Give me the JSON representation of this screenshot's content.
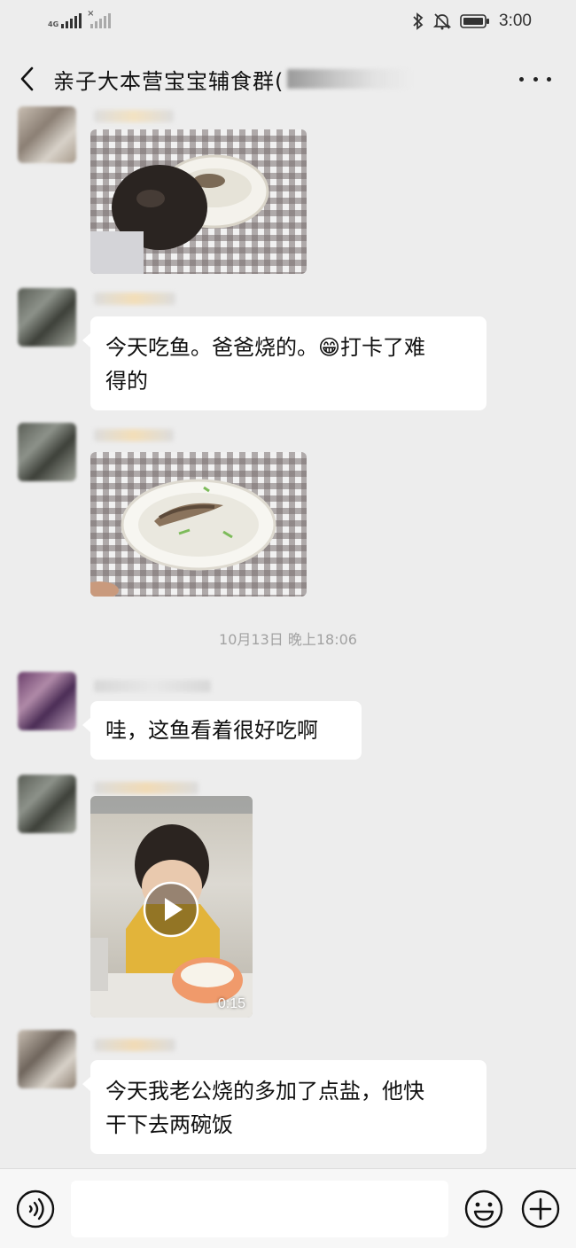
{
  "status_bar": {
    "network_label": "4G",
    "time": "3:00",
    "icons": [
      "signal-icon",
      "no-sim-signal-icon",
      "bluetooth-icon",
      "mute-icon",
      "battery-icon"
    ]
  },
  "header": {
    "title": "亲子大本营宝宝辅食群(",
    "back_icon": "chevron-left-icon",
    "more_icon": "more-dots-icon"
  },
  "messages": [
    {
      "type": "image",
      "description_icon": "photo-child-eating-fish"
    },
    {
      "type": "text",
      "lines": [
        "今天吃鱼。爸爸烧的。😁打卡了难",
        "得的"
      ]
    },
    {
      "type": "image",
      "description_icon": "photo-fish-dish"
    },
    {
      "type": "timestamp",
      "text": "10月13日 晚上18:06"
    },
    {
      "type": "text",
      "lines": [
        "哇，这鱼看着很好吃啊"
      ]
    },
    {
      "type": "video",
      "duration": "0:15"
    },
    {
      "type": "text",
      "lines": [
        "今天我老公烧的多加了点盐，他快",
        "干下去两碗饭"
      ]
    }
  ],
  "bottom_bar": {
    "voice_icon": "voice-icon",
    "emoji_icon": "emoji-icon",
    "plus_icon": "plus-icon",
    "input_value": ""
  },
  "colors": {
    "background": "#ededed",
    "bubble": "#ffffff",
    "timestamp": "#a2a2a2"
  }
}
